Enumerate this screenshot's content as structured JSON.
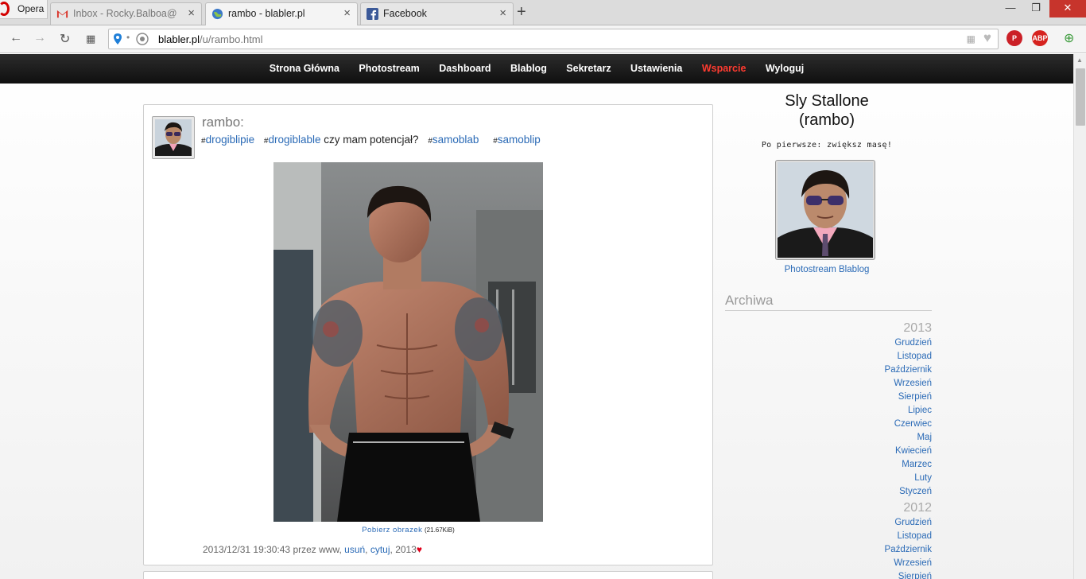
{
  "browser": {
    "menu_label": "Opera",
    "tabs": [
      {
        "title": "Inbox - Rocky.Balboa@",
        "icon": "gmail-icon"
      },
      {
        "title": "rambo - blabler.pl",
        "icon": "globe-icon"
      },
      {
        "title": "Facebook",
        "icon": "facebook-icon"
      }
    ],
    "url_host": "blabler.pl",
    "url_path": "/u/rambo.html",
    "extensions": {
      "adblock": "ABP"
    }
  },
  "site_nav": {
    "items": [
      "Strona Główna",
      "Photostream",
      "Dashboard",
      "Blablog",
      "Sekretarz",
      "Ustawienia",
      "Wsparcie",
      "Wyloguj"
    ],
    "highlight_color": "#ff3b30"
  },
  "post": {
    "username": "rambo:",
    "hashtags_before": [
      "drogiblipie",
      "drogiblable"
    ],
    "text": "czy mam potencjał?",
    "hashtags_after": [
      "samoblab",
      "samoblip"
    ],
    "hash_symbol": "#",
    "download_label": "Pobierz obrazek",
    "download_size": "(21.67KiB)",
    "timestamp": "2013/12/31 19:30:43 przez www,",
    "action_delete": "usuń",
    "action_quote": "cytuj",
    "like_count": "2013",
    "heart": "♥"
  },
  "sidebar": {
    "name_line1": "Sly Stallone",
    "name_line2": "(rambo)",
    "motto": "Po pierwsze: zwiększ masę!",
    "links": [
      "Photostream",
      "Blablog"
    ],
    "archive_title": "Archiwa",
    "years": [
      {
        "year": "2013",
        "months": [
          "Grudzień",
          "Listopad",
          "Październik",
          "Wrzesień",
          "Sierpień",
          "Lipiec",
          "Czerwiec",
          "Maj",
          "Kwiecień",
          "Marzec",
          "Luty",
          "Styczeń"
        ]
      },
      {
        "year": "2012",
        "months": [
          "Grudzień",
          "Listopad",
          "Październik",
          "Wrzesień",
          "Sierpień"
        ]
      }
    ]
  }
}
